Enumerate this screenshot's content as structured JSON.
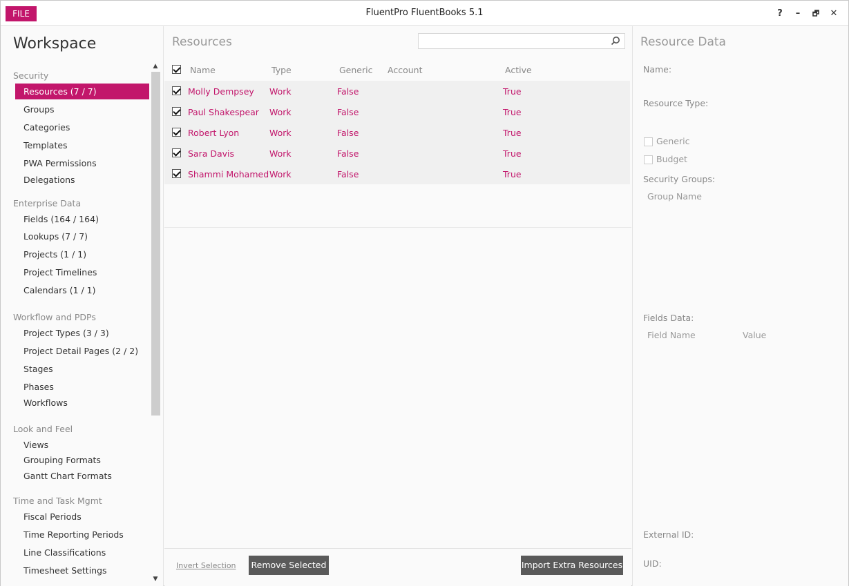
{
  "titlebar": {
    "file_label": "FILE",
    "title": "FluentPro FluentBooks 5.1",
    "help": "?",
    "minimize": "–",
    "maximize": "🗗",
    "close": "✕"
  },
  "sidebar": {
    "title": "Workspace",
    "sections": [
      {
        "heading": "Security",
        "items": [
          "Resources (7 / 7)",
          "Groups",
          "Categories",
          "Templates",
          "PWA Permissions",
          "Delegations"
        ]
      },
      {
        "heading": "Enterprise Data",
        "items": [
          "Fields (164 / 164)",
          "Lookups (7 / 7)",
          "Projects (1 / 1)",
          "Project Timelines",
          "Calendars (1 / 1)"
        ]
      },
      {
        "heading": "Workflow and PDPs",
        "items": [
          "Project Types (3 / 3)",
          "Project Detail Pages (2 / 2)",
          "Stages",
          "Phases",
          "Workflows"
        ]
      },
      {
        "heading": "Look and Feel",
        "items": [
          "Views",
          "Grouping Formats",
          "Gantt Chart Formats"
        ]
      },
      {
        "heading": "Time and Task Mgmt",
        "items": [
          "Fiscal Periods",
          "Time Reporting Periods",
          "Line Classifications",
          "Timesheet Settings"
        ]
      }
    ],
    "scroll_up": "▲",
    "scroll_down": "▼"
  },
  "main": {
    "title": "Resources",
    "search_value": "",
    "columns": [
      "Name",
      "Type",
      "Generic",
      "Account",
      "Active"
    ],
    "rows": [
      {
        "name": "Molly Dempsey",
        "type": "Work",
        "generic": "False",
        "account": "",
        "active": "True"
      },
      {
        "name": "Paul Shakespear",
        "type": "Work",
        "generic": "False",
        "account": "",
        "active": "True"
      },
      {
        "name": "Robert Lyon",
        "type": "Work",
        "generic": "False",
        "account": "",
        "active": "True"
      },
      {
        "name": "Sara Davis",
        "type": "Work",
        "generic": "False",
        "account": "",
        "active": "True"
      },
      {
        "name": "Shammi Mohamed",
        "type": "Work",
        "generic": "False",
        "account": "",
        "active": "True"
      }
    ],
    "invert_selection": "Invert Selection",
    "remove_selected": "Remove Selected",
    "import_extra": "Import Extra Resources"
  },
  "resource_data": {
    "title": "Resource Data",
    "name_label": "Name:",
    "type_label": "Resource Type:",
    "generic_label": "Generic",
    "budget_label": "Budget",
    "groups_label": "Security Groups:",
    "group_name_col": "Group Name",
    "fields_label": "Fields Data:",
    "field_name_col": "Field Name",
    "value_col": "Value",
    "external_id_label": "External ID:",
    "uid_label": "UID:"
  },
  "colors": {
    "accent": "#c2166b",
    "button_dark": "#5a5a5a"
  }
}
